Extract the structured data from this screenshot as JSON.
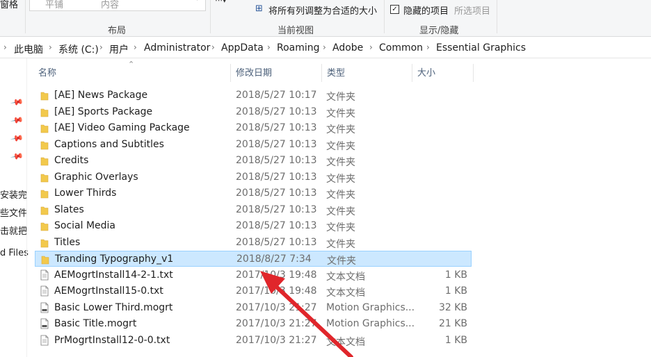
{
  "ribbon": {
    "pane_label": "窗格",
    "tile_label": "平铺",
    "content_label": "内容",
    "fit_columns_label": "将所有列调整为合适的大小",
    "hidden_items_label": "隐藏的项目",
    "hide_selected_label": "所选项目",
    "group_layout": "布局",
    "group_current_view": "当前视图",
    "group_show_hide": "显示/隐藏"
  },
  "breadcrumb": [
    "此电脑",
    "系统 (C:)",
    "用户",
    "Administrator",
    "AppData",
    "Roaming",
    "Adobe",
    "Common",
    "Essential Graphics"
  ],
  "nav": {
    "item1": "安装完",
    "item2": "些文件",
    "item3": "击就把",
    "item4": "d Files"
  },
  "columns": {
    "name": "名称",
    "date": "修改日期",
    "type": "类型",
    "size": "大小"
  },
  "files": [
    {
      "name": "[AE] News Package",
      "date": "2018/5/27 10:17",
      "type": "文件夹",
      "size": "",
      "kind": "folder"
    },
    {
      "name": "[AE] Sports Package",
      "date": "2018/5/27 10:13",
      "type": "文件夹",
      "size": "",
      "kind": "folder"
    },
    {
      "name": "[AE] Video Gaming Package",
      "date": "2018/5/27 10:13",
      "type": "文件夹",
      "size": "",
      "kind": "folder"
    },
    {
      "name": "Captions and Subtitles",
      "date": "2018/5/27 10:13",
      "type": "文件夹",
      "size": "",
      "kind": "folder"
    },
    {
      "name": "Credits",
      "date": "2018/5/27 10:13",
      "type": "文件夹",
      "size": "",
      "kind": "folder"
    },
    {
      "name": "Graphic Overlays",
      "date": "2018/5/27 10:13",
      "type": "文件夹",
      "size": "",
      "kind": "folder"
    },
    {
      "name": "Lower Thirds",
      "date": "2018/5/27 10:13",
      "type": "文件夹",
      "size": "",
      "kind": "folder"
    },
    {
      "name": "Slates",
      "date": "2018/5/27 10:13",
      "type": "文件夹",
      "size": "",
      "kind": "folder"
    },
    {
      "name": "Social Media",
      "date": "2018/5/27 10:13",
      "type": "文件夹",
      "size": "",
      "kind": "folder"
    },
    {
      "name": "Titles",
      "date": "2018/5/27 10:13",
      "type": "文件夹",
      "size": "",
      "kind": "folder"
    },
    {
      "name": "Tranding Typography_v1",
      "date": "2018/8/27 7:34",
      "type": "文件夹",
      "size": "",
      "kind": "folder",
      "selected": true
    },
    {
      "name": "AEMogrtInstall14-2-1.txt",
      "date": "2017/10/3 19:48",
      "type": "文本文档",
      "size": "1 KB",
      "kind": "file"
    },
    {
      "name": "AEMogrtInstall15-0.txt",
      "date": "2017/10/3 19:48",
      "type": "文本文档",
      "size": "1 KB",
      "kind": "file"
    },
    {
      "name": "Basic Lower Third.mogrt",
      "date": "2017/10/3 21:27",
      "type": "Motion Graphics...",
      "size": "32 KB",
      "kind": "mogrt"
    },
    {
      "name": "Basic Title.mogrt",
      "date": "2017/10/3 21:27",
      "type": "Motion Graphics...",
      "size": "21 KB",
      "kind": "mogrt"
    },
    {
      "name": "PrMogrtInstall12-0-0.txt",
      "date": "2017/10/3 21:27",
      "type": "文本文档",
      "size": "1 KB",
      "kind": "file"
    }
  ],
  "colors": {
    "selection_bg": "#cce8ff",
    "folder": "#f2c94c",
    "arrow": "#e0262b"
  }
}
